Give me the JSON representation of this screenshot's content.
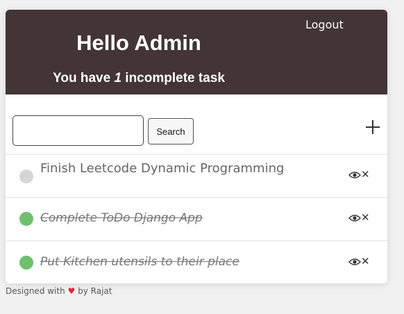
{
  "header": {
    "logout_label": "Logout",
    "greeting": "Hello Admin",
    "subtitle_prefix": "You have",
    "incomplete_count": "1",
    "subtitle_suffix": "incomplete task"
  },
  "toolbar": {
    "search_value": "",
    "search_button_label": "Search",
    "add_icon": "plus-icon"
  },
  "tasks": [
    {
      "title": "Finish Leetcode Dynamic Programming",
      "completed": false,
      "status_color": "#d6d6d6"
    },
    {
      "title": "Complete ToDo Django App",
      "completed": true,
      "status_color": "#6fbf6f"
    },
    {
      "title": "Put Kitchen utensils to their place",
      "completed": true,
      "status_color": "#6fbf6f"
    }
  ],
  "footer": {
    "prefix": "Designed with",
    "heart": "♥",
    "suffix": "by Rajat"
  },
  "colors": {
    "header_bg": "#433535",
    "completed_dot": "#6fbf6f",
    "incomplete_dot": "#d6d6d6",
    "heart": "#e0263a"
  }
}
